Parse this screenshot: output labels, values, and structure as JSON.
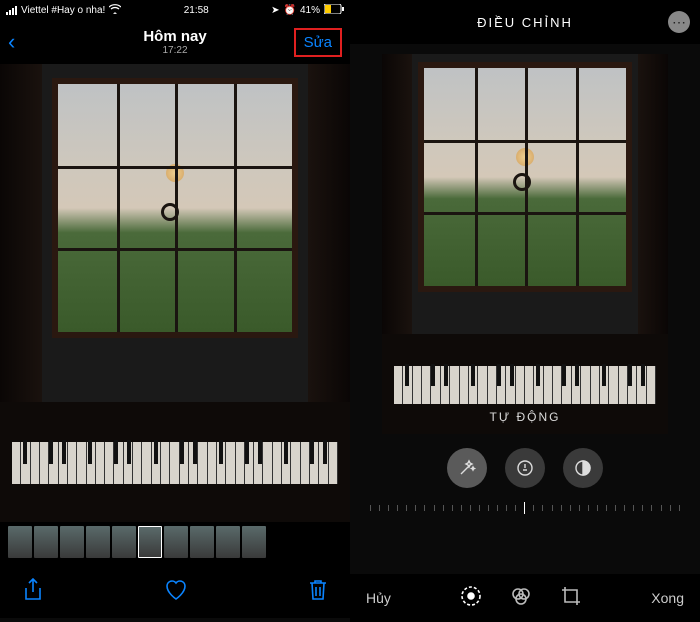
{
  "status": {
    "carrier": "Viettel #Hay o nha!",
    "time": "21:58",
    "battery": "41%"
  },
  "left": {
    "title": "Hôm nay",
    "subtitle": "17:22",
    "edit": "Sửa"
  },
  "right": {
    "title": "ĐIỀU CHỈNH",
    "auto": "TỰ ĐỘNG",
    "cancel": "Hủy",
    "done": "Xong"
  }
}
